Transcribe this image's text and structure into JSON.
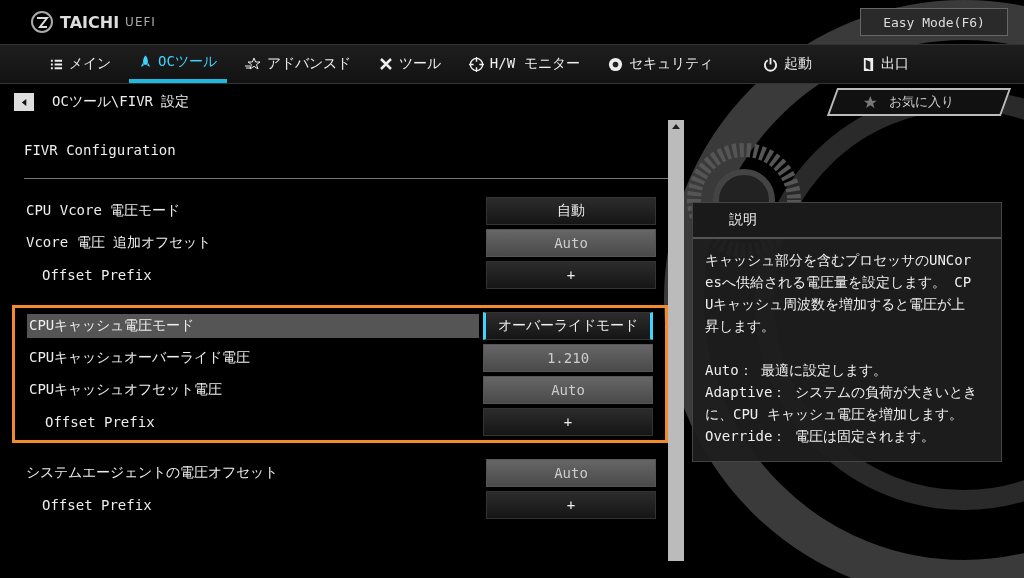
{
  "header": {
    "logo_text": "TAICHI",
    "logo_sub": "UEFI",
    "mode_button": "Easy Mode(F6)"
  },
  "tabs": [
    {
      "label": "メイン",
      "selected": false
    },
    {
      "label": "OCツール",
      "selected": true
    },
    {
      "label": "アドバンスド",
      "selected": false
    },
    {
      "label": "ツール",
      "selected": false
    },
    {
      "label": "H/W モニター",
      "selected": false
    },
    {
      "label": "セキュリティ",
      "selected": false
    },
    {
      "label": "起動",
      "selected": false
    },
    {
      "label": "出口",
      "selected": false
    }
  ],
  "breadcrumb": "OCツール\\FIVR 設定",
  "favorites": "お気に入り",
  "section_title": "FIVR Configuration",
  "groups": [
    {
      "outlined": false,
      "rows": [
        {
          "label": "CPU Vcore 電圧モード",
          "value": "自動",
          "kind": "select",
          "selected": false
        },
        {
          "label": "Vcore 電圧 追加オフセット",
          "value": "Auto",
          "kind": "input",
          "selected": false,
          "children": [
            {
              "label": "Offset Prefix",
              "value": "+",
              "kind": "select",
              "selected": false
            }
          ]
        }
      ]
    },
    {
      "outlined": true,
      "rows": [
        {
          "label": "CPUキャッシュ電圧モード",
          "value": "オーバーライドモード",
          "kind": "select",
          "selected": true
        },
        {
          "label": "CPUキャッシュオーバーライド電圧",
          "value": "1.210",
          "kind": "input",
          "selected": false
        },
        {
          "label": "CPUキャッシュオフセット電圧",
          "value": "Auto",
          "kind": "input",
          "selected": false,
          "children": [
            {
              "label": "Offset Prefix",
              "value": "+",
              "kind": "select",
              "selected": false
            }
          ]
        }
      ]
    },
    {
      "outlined": false,
      "rows": [
        {
          "label": "システムエージェントの電圧オフセット",
          "value": "Auto",
          "kind": "input",
          "selected": false,
          "children": [
            {
              "label": "Offset Prefix",
              "value": "+",
              "kind": "select",
              "selected": false
            }
          ]
        }
      ]
    }
  ],
  "description": {
    "title": "説明",
    "blocks": [
      [
        "キャッシュ部分を含むプロセッサのUNCoresへ供給される電圧量を設定します。 CPUキャッシュ周波数を増加すると電圧が上昇します。"
      ],
      [
        "Auto： 最適に設定します。",
        "Adaptive： システムの負荷が大きいときに、CPU キャッシュ電圧を増加します。",
        "Override： 電圧は固定されます。"
      ]
    ]
  }
}
